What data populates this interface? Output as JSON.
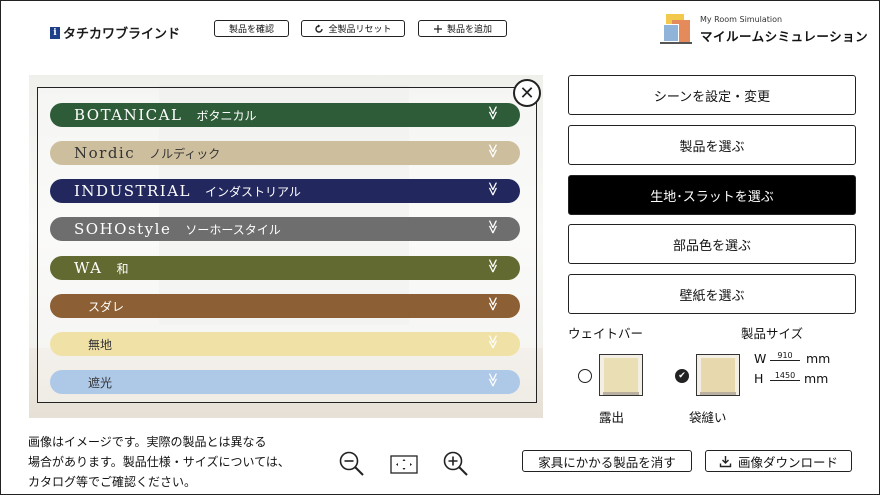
{
  "header": {
    "logo_mark": "i",
    "logo_text": "タチカワブラインド",
    "confirm_label": "製品を確認",
    "reset_label": "全製品リセット",
    "add_label": "製品を追加",
    "brand_sub": "My Room Simulation",
    "brand_main": "マイルームシミュレーション"
  },
  "categories": [
    {
      "en": "BOTANICAL",
      "jp": "ボタニカル",
      "color": "#2e5c38"
    },
    {
      "en": "Nordic",
      "jp": "ノルディック",
      "color": "#cdbf9e"
    },
    {
      "en": "INDUSTRIAL",
      "jp": "インダストリアル",
      "color": "#22285e"
    },
    {
      "en": "SOHOstyle",
      "jp": "ソーホースタイル",
      "color": "#6e6e6e"
    },
    {
      "en": "WA",
      "jp": "和",
      "color": "#626a31"
    },
    {
      "en": "",
      "jp": "スダレ",
      "color": "#8c5f34"
    },
    {
      "en": "",
      "jp": "無地",
      "color": "#f0e1a6"
    },
    {
      "en": "",
      "jp": "遮光",
      "color": "#aec8e8"
    }
  ],
  "close_glyph": "✕",
  "chevron_glyph": "≫",
  "sidebar": {
    "scene": "シーンを設定・変更",
    "product": "製品を選ぶ",
    "fabric": "生地･スラットを選ぶ",
    "part_color": "部品色を選ぶ",
    "wallpaper": "壁紙を選ぶ"
  },
  "weight_bar": {
    "title": "ウェイトバー",
    "option1": "露出",
    "option2": "袋縫い",
    "selected": "袋縫い"
  },
  "size": {
    "title": "製品サイズ",
    "w_label": "W",
    "w_value": "910",
    "h_label": "H",
    "h_value": "1450",
    "unit": "mm"
  },
  "footer": {
    "disclaimer_1": "画像はイメージです。実際の製品とは異なる",
    "disclaimer_2": "場合があります。製品仕様・サイズについては、",
    "disclaimer_3": "カタログ等でご確認ください。",
    "erase_label": "家具にかかる製品を消す",
    "download_label": "画像ダウンロード"
  },
  "icons": [
    "info-logo-icon",
    "reset-icon",
    "plus-icon",
    "close-icon",
    "chevron-down-icon",
    "zoom-out-icon",
    "fit-screen-icon",
    "zoom-in-icon",
    "download-icon",
    "check-icon"
  ]
}
